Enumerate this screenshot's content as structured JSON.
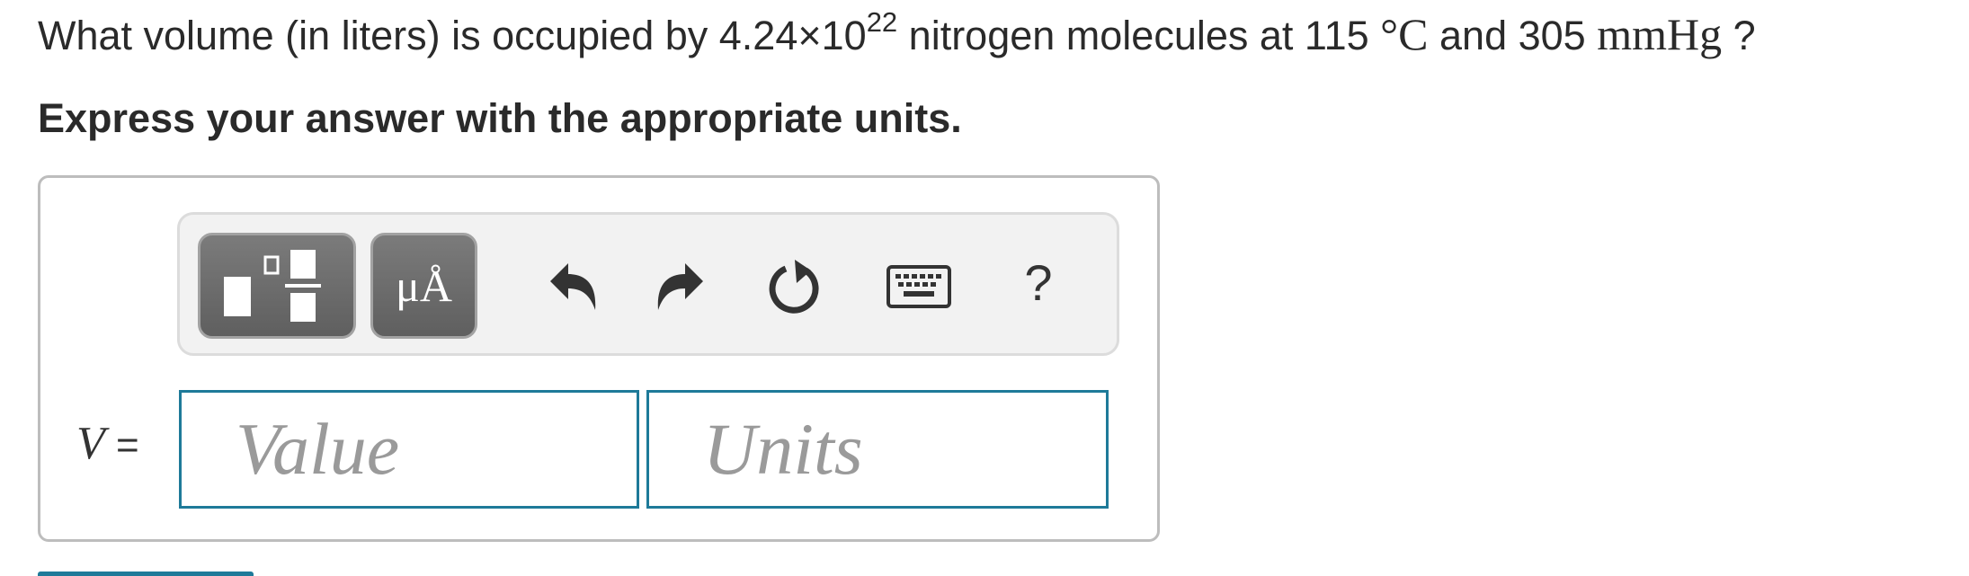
{
  "question": {
    "prefix": "What volume (in liters) is occupied by 4.24×10",
    "exponent": "22",
    "middle": " nitrogen molecules at 115 ",
    "degree": "°C",
    "and_text": " and 305 ",
    "pressure_unit": "mmHg",
    "suffix": " ?"
  },
  "instruction": "Express your answer with the appropriate units.",
  "toolbar": {
    "units_button_label": "μÅ",
    "help_label": "?"
  },
  "answer": {
    "variable": "V",
    "equals": " =",
    "value_placeholder": "Value",
    "units_placeholder": "Units"
  },
  "colors": {
    "accent": "#1e7a99",
    "tool_button": "#6b6b6b",
    "toolbar_bg": "#f2f2f2"
  },
  "icons": [
    "templates-icon",
    "units-icon",
    "undo-icon",
    "redo-icon",
    "reset-icon",
    "keyboard-icon",
    "help-icon"
  ]
}
